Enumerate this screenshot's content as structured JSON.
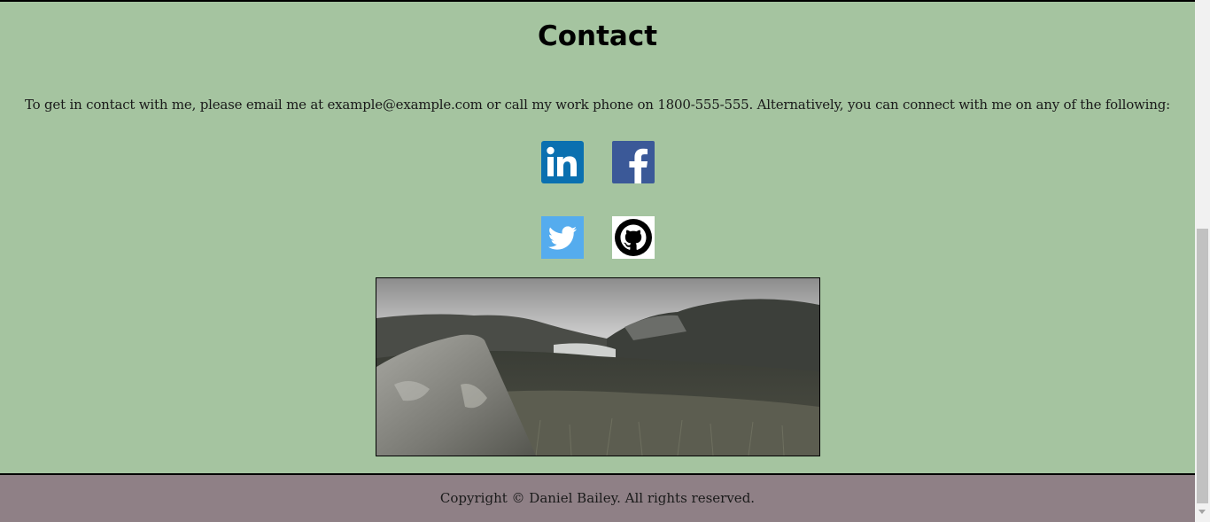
{
  "contact": {
    "title": "Contact",
    "intro": "To get in contact with me, please email me at example@example.com or call my work phone on 1800-555-555. Alternatively, you can connect with me on any of the following:"
  },
  "social": [
    {
      "name": "LinkedIn",
      "icon": "linkedin-icon",
      "color": "#0a66c2"
    },
    {
      "name": "Facebook",
      "icon": "facebook-icon",
      "color": "#3b5998"
    },
    {
      "name": "Twitter",
      "icon": "twitter-icon",
      "color": "#55acee"
    },
    {
      "name": "GitHub",
      "icon": "github-icon",
      "color": "#000000"
    }
  ],
  "photo": {
    "subject": "landscape-photo"
  },
  "footer": {
    "copyright": "Copyright © Daniel Bailey. All rights reserved."
  },
  "colors": {
    "background": "#a5c4a0",
    "footer_background": "#8f8086"
  }
}
